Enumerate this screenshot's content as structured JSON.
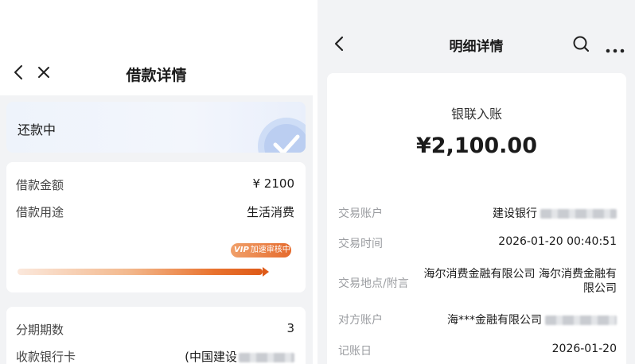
{
  "loan": {
    "nav": {
      "title": "借款详情",
      "back_icon": "chevron-left-icon",
      "close_icon": "close-icon"
    },
    "status": {
      "label": "还款中",
      "badge_icon": "check-circle-icon"
    },
    "info": {
      "amount_label": "借款金额",
      "amount_value": "¥ 2100",
      "purpose_label": "借款用途",
      "purpose_value": "生活消费",
      "vip_tag": "VIP",
      "vip_text": "加速审核中",
      "progress": 0.98
    },
    "plan": {
      "installments_label": "分期期数",
      "installments_value": "3",
      "bank_card_label": "收款银行卡",
      "bank_card_value": "(中国建设"
    }
  },
  "detail": {
    "nav": {
      "title": "明细详情",
      "back_icon": "chevron-left-icon",
      "search_icon": "search-icon",
      "more_icon": "more-horizontal-icon"
    },
    "kind": "银联入账",
    "amount": "¥2,100.00",
    "rows": [
      {
        "label": "交易账户",
        "value": "建设银行"
      },
      {
        "label": "交易时间",
        "value": "2026-01-20 00:40:51"
      },
      {
        "label": "交易地点/附言",
        "value": "海尔消费金融有限公司 海尔消费金融有限公司"
      },
      {
        "label": "对方账户",
        "value": "海***金融有限公司"
      },
      {
        "label": "记账日",
        "value": "2026-01-20"
      }
    ]
  },
  "colors": {
    "accent_orange": "#e56a2c",
    "page_bg": "#f2f3f5",
    "card_bg": "#ffffff",
    "muted_text": "#9a9ca0"
  }
}
